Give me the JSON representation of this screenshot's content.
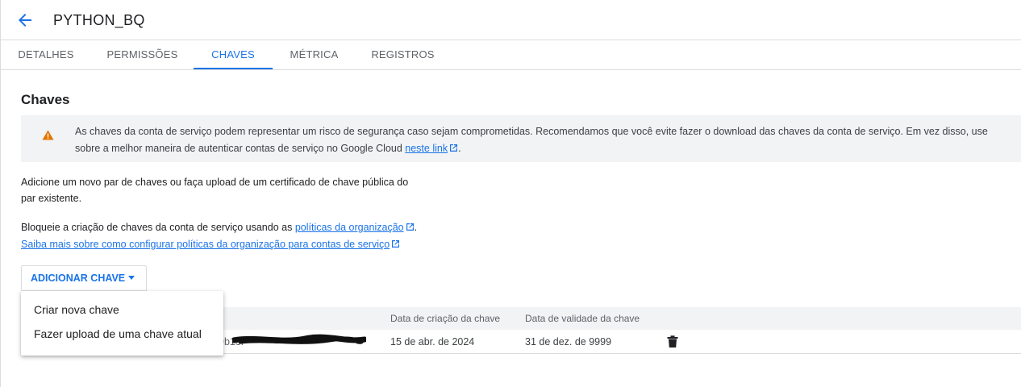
{
  "header": {
    "title": "PYTHON_BQ",
    "back_icon": "arrow-back-icon"
  },
  "tabs": [
    {
      "label": "DETALHES",
      "active": false
    },
    {
      "label": "PERMISSÕES",
      "active": false
    },
    {
      "label": "CHAVES",
      "active": true
    },
    {
      "label": "MÉTRICA",
      "active": false
    },
    {
      "label": "REGISTROS",
      "active": false
    }
  ],
  "main": {
    "title": "Chaves",
    "warning": {
      "icon": "warning-icon",
      "line1": "As chaves da conta de serviço podem representar um risco de segurança caso sejam comprometidas. Recomendamos que você evite fazer o download das chaves da conta de serviço. Em vez disso, use",
      "line2_prefix": "sobre a melhor maneira de autenticar contas de serviço no Google Cloud ",
      "link": "neste link",
      "line2_suffix": "."
    },
    "add_text_line1": "Adicione um novo par de chaves ou faça upload de um certificado de chave pública do",
    "add_text_line2": "par existente.",
    "block_prefix": "Bloqueie a criação de chaves da conta de serviço usando as ",
    "block_link": "políticas da organização",
    "block_suffix": ".",
    "learn_more_link": "Saiba mais sobre como configurar políticas da organização para contas de serviço",
    "add_button": "ADICIONAR CHAVE",
    "menu": [
      "Criar nova chave",
      "Fazer upload de uma chave atual"
    ],
    "table": {
      "headers": {
        "created": "Data de criação da chave",
        "expires": "Data de validade da chave"
      },
      "rows": [
        {
          "key_id_partial": "9b13f",
          "created": "15 de abr. de 2024",
          "expires": "31 de dez. de 9999"
        }
      ]
    }
  },
  "colors": {
    "accent": "#1a73e8",
    "warning": "#e37400",
    "gray_bg": "#f1f3f4",
    "border": "#dadce0"
  }
}
